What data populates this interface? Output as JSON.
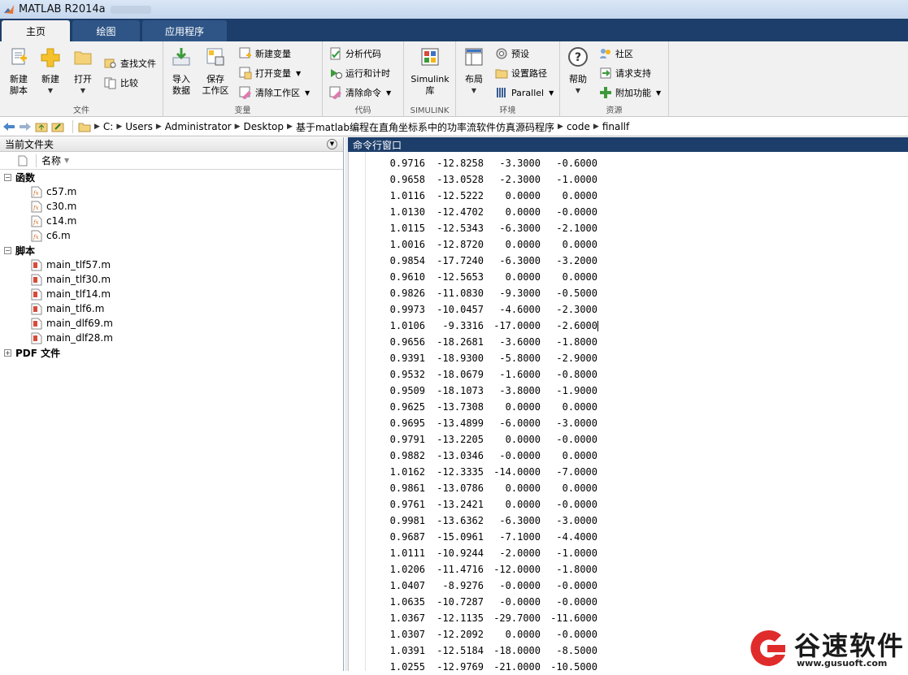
{
  "window": {
    "title": "MATLAB R2014a"
  },
  "tabs": [
    {
      "label": "主页",
      "active": true
    },
    {
      "label": "绘图"
    },
    {
      "label": "应用程序"
    }
  ],
  "ribbon": {
    "file": {
      "label": "文件",
      "new_script": "新建\n脚本",
      "new": "新建",
      "open": "打开",
      "find_files": "查找文件",
      "compare": "比较"
    },
    "variable": {
      "label": "变量",
      "import": "导入\n数据",
      "save_ws": "保存\n工作区",
      "new_var": "新建变量",
      "open_var": "打开变量",
      "clear_ws": "清除工作区"
    },
    "code": {
      "label": "代码",
      "analyze": "分析代码",
      "run_time": "运行和计时",
      "clear_cmd": "清除命令"
    },
    "simulink": {
      "label": "SIMULINK",
      "lib": "Simulink\n库"
    },
    "env": {
      "label": "环境",
      "layout": "布局",
      "prefs": "预设",
      "set_path": "设置路径",
      "parallel": "Parallel"
    },
    "resources": {
      "label": "资源",
      "help": "帮助",
      "community": "社区",
      "support": "请求支持",
      "addons": "附加功能"
    }
  },
  "address": {
    "crumbs": [
      "C:",
      "Users",
      "Administrator",
      "Desktop",
      "基于matlab编程在直角坐标系中的功率流软件仿真源码程序",
      "code",
      "finallf"
    ]
  },
  "current_folder": {
    "title": "当前文件夹",
    "column": "名称",
    "groups": [
      {
        "name": "函数",
        "files": [
          "c57.m",
          "c30.m",
          "c14.m",
          "c6.m"
        ]
      },
      {
        "name": "脚本",
        "files": [
          "main_tlf57.m",
          "main_tlf30.m",
          "main_tlf14.m",
          "main_tlf6.m",
          "main_dlf69.m",
          "main_dlf28.m"
        ]
      },
      {
        "name": "PDF 文件",
        "files": []
      }
    ]
  },
  "command_window": {
    "title": "命令行窗口",
    "rows": [
      [
        "0.9716",
        "-12.8258",
        "-3.3000",
        "-0.6000"
      ],
      [
        "0.9658",
        "-13.0528",
        "-2.3000",
        "-1.0000"
      ],
      [
        "1.0116",
        "-12.5222",
        "0.0000",
        "0.0000"
      ],
      [
        "1.0130",
        "-12.4702",
        "0.0000",
        "-0.0000"
      ],
      [
        "1.0115",
        "-12.5343",
        "-6.3000",
        "-2.1000"
      ],
      [
        "1.0016",
        "-12.8720",
        "0.0000",
        "0.0000"
      ],
      [
        "0.9854",
        "-17.7240",
        "-6.3000",
        "-3.2000"
      ],
      [
        "0.9610",
        "-12.5653",
        "0.0000",
        "0.0000"
      ],
      [
        "0.9826",
        "-11.0830",
        "-9.3000",
        "-0.5000"
      ],
      [
        "0.9973",
        "-10.0457",
        "-4.6000",
        "-2.3000"
      ],
      [
        "1.0106",
        "-9.3316",
        "-17.0000",
        "-2.6000"
      ],
      [
        "0.9656",
        "-18.2681",
        "-3.6000",
        "-1.8000"
      ],
      [
        "0.9391",
        "-18.9300",
        "-5.8000",
        "-2.9000"
      ],
      [
        "0.9532",
        "-18.0679",
        "-1.6000",
        "-0.8000"
      ],
      [
        "0.9509",
        "-18.1073",
        "-3.8000",
        "-1.9000"
      ],
      [
        "0.9625",
        "-13.7308",
        "0.0000",
        "0.0000"
      ],
      [
        "0.9695",
        "-13.4899",
        "-6.0000",
        "-3.0000"
      ],
      [
        "0.9791",
        "-13.2205",
        "0.0000",
        "-0.0000"
      ],
      [
        "0.9882",
        "-13.0346",
        "-0.0000",
        "0.0000"
      ],
      [
        "1.0162",
        "-12.3335",
        "-14.0000",
        "-7.0000"
      ],
      [
        "0.9861",
        "-13.0786",
        "0.0000",
        "0.0000"
      ],
      [
        "0.9761",
        "-13.2421",
        "0.0000",
        "-0.0000"
      ],
      [
        "0.9981",
        "-13.6362",
        "-6.3000",
        "-3.0000"
      ],
      [
        "0.9687",
        "-15.0961",
        "-7.1000",
        "-4.4000"
      ],
      [
        "1.0111",
        "-10.9244",
        "-2.0000",
        "-1.0000"
      ],
      [
        "1.0206",
        "-11.4716",
        "-12.0000",
        "-1.8000"
      ],
      [
        "1.0407",
        "-8.9276",
        "-0.0000",
        "-0.0000"
      ],
      [
        "1.0635",
        "-10.7287",
        "-0.0000",
        "-0.0000"
      ],
      [
        "1.0367",
        "-12.1135",
        "-29.7000",
        "-11.6000"
      ],
      [
        "1.0307",
        "-12.2092",
        "0.0000",
        "-0.0000"
      ],
      [
        "1.0391",
        "-12.5184",
        "-18.0000",
        "-8.5000"
      ],
      [
        "1.0255",
        "-12.9769",
        "-21.0000",
        "-10.5000"
      ]
    ]
  },
  "watermark": {
    "title": "谷速软件",
    "url": "www.gusuoft.com"
  }
}
